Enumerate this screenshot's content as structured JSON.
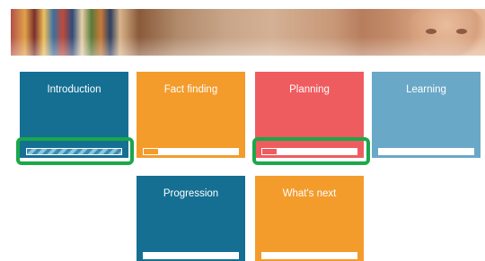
{
  "banner": {
    "icon": "books-and-face-photo"
  },
  "tiles": [
    {
      "label": "Introduction",
      "color": "#156f93",
      "progress": 1.0
    },
    {
      "label": "Fact finding",
      "color": "#f39c2c",
      "progress": 0.15
    },
    {
      "label": "Planning",
      "color": "#ef5c60",
      "progress": 0.15
    },
    {
      "label": "Learning",
      "color": "#6aa8c8",
      "progress": 0.0
    },
    {
      "label": "Progression",
      "color": "#156f93",
      "progress": 0.0
    },
    {
      "label": "What's next",
      "color": "#f39c2c",
      "progress": 0.0
    }
  ],
  "highlights": [
    "Introduction",
    "Planning"
  ]
}
